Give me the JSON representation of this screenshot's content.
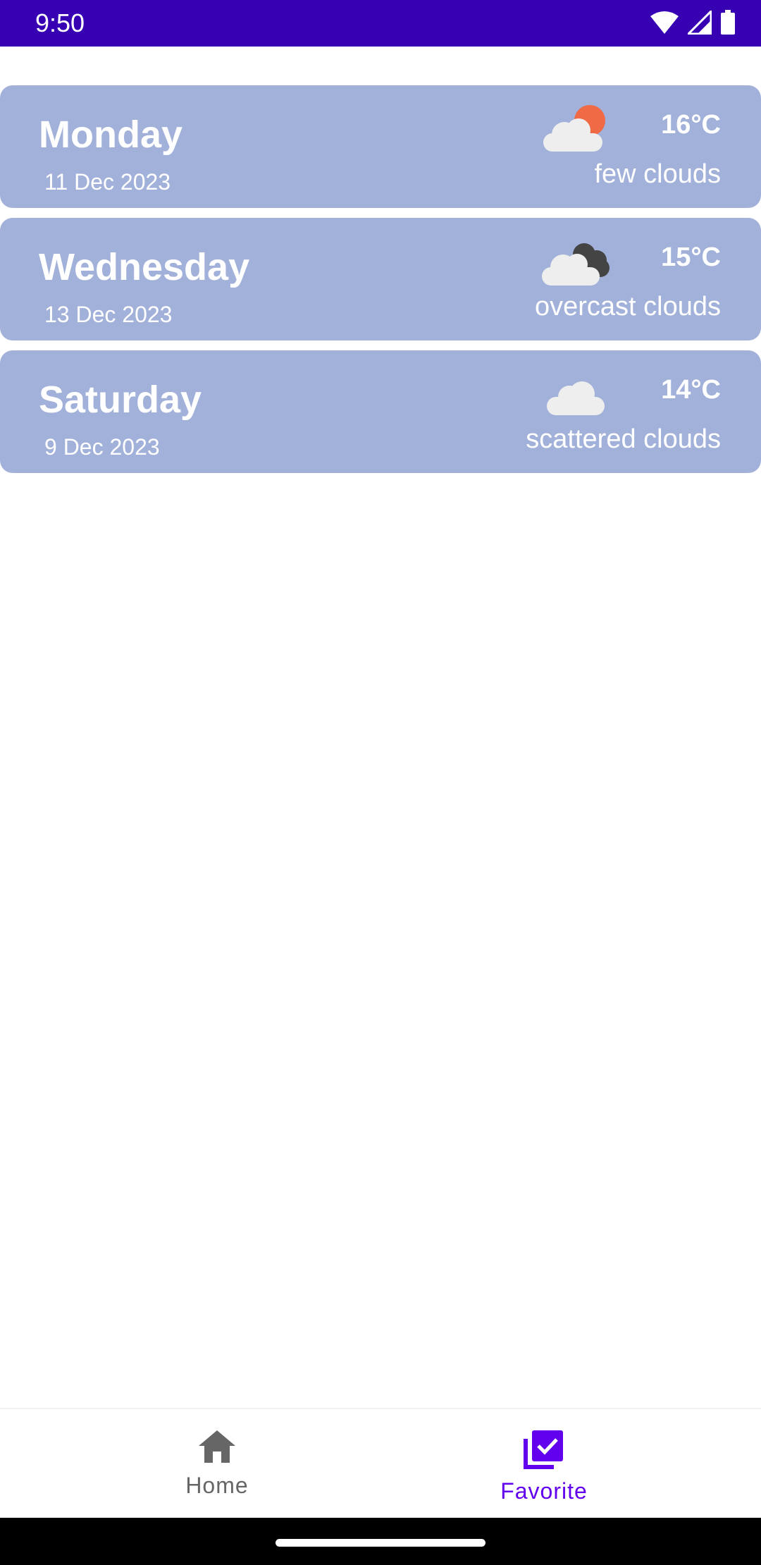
{
  "status_bar": {
    "time": "9:50",
    "icons": [
      "wifi-icon",
      "signal-icon",
      "battery-icon"
    ],
    "background": "#3700b3"
  },
  "cards": [
    {
      "day": "Monday",
      "date": "11 Dec 2023",
      "temp": "16°C",
      "description": "few clouds",
      "icon": "few-clouds-icon"
    },
    {
      "day": "Wednesday",
      "date": "13 Dec 2023",
      "temp": "15°C",
      "description": "overcast clouds",
      "icon": "overcast-clouds-icon"
    },
    {
      "day": "Saturday",
      "date": "9 Dec 2023",
      "temp": "14°C",
      "description": "scattered clouds",
      "icon": "scattered-clouds-icon"
    }
  ],
  "card_color": "#a2b1da",
  "bottom_nav": {
    "items": [
      {
        "label": "Home",
        "icon": "home-icon",
        "selected": false
      },
      {
        "label": "Favorite",
        "icon": "favorite-check-icon",
        "selected": true
      }
    ],
    "accent": "#6200ee"
  }
}
